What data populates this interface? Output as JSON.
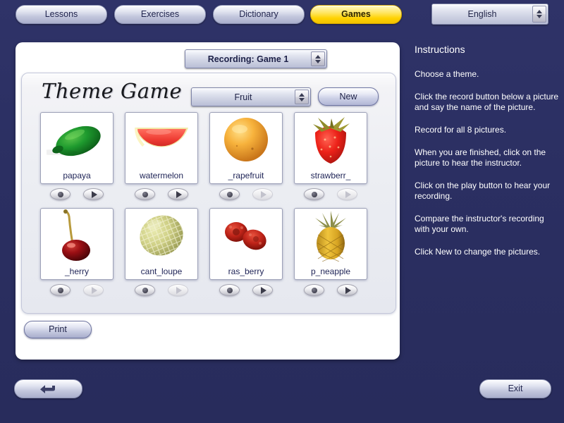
{
  "nav": {
    "tabs": [
      {
        "label": "Lessons",
        "active": false
      },
      {
        "label": "Exercises",
        "active": false
      },
      {
        "label": "Dictionary",
        "active": false
      },
      {
        "label": "Games",
        "active": true
      }
    ],
    "language": "English",
    "active_tab_color": "#ffd200",
    "bar_color": "#2b2f62"
  },
  "recording": {
    "label": "Recording: Game 1"
  },
  "game": {
    "title": "Theme Game",
    "theme": "Fruit",
    "new_label": "New",
    "print_label": "Print",
    "record_icon": "microphone-icon",
    "play_icon": "play-triangle-icon",
    "rows": [
      [
        {
          "label": "papaya",
          "art": "papaya",
          "record_enabled": true,
          "play_enabled": true
        },
        {
          "label": "watermelon",
          "art": "watermelon",
          "record_enabled": true,
          "play_enabled": true
        },
        {
          "label": "_rapefruit",
          "art": "grapefruit",
          "record_enabled": true,
          "play_enabled": false
        },
        {
          "label": "strawberr_",
          "art": "strawberry",
          "record_enabled": true,
          "play_enabled": false
        }
      ],
      [
        {
          "label": "_herry",
          "art": "cherry",
          "record_enabled": true,
          "play_enabled": false
        },
        {
          "label": "cant_loupe",
          "art": "cantaloupe",
          "record_enabled": true,
          "play_enabled": false
        },
        {
          "label": "ras_berry",
          "art": "raspberry",
          "record_enabled": true,
          "play_enabled": true
        },
        {
          "label": "p_neapple",
          "art": "pineapple",
          "record_enabled": true,
          "play_enabled": true
        }
      ]
    ]
  },
  "instructions": {
    "title": "Instructions",
    "paragraphs": [
      "Choose a theme.",
      "Click the record button below a picture and say the name of the picture.",
      "Record for all 8 pictures.",
      "When you are finished, click on the picture to hear the instructor.",
      "Click on the play button to hear your recording.",
      "Compare the instructor's recording with your own.",
      "Click New to change the pictures."
    ]
  },
  "footer": {
    "back_icon": "return-arrow-icon",
    "exit_label": "Exit"
  }
}
